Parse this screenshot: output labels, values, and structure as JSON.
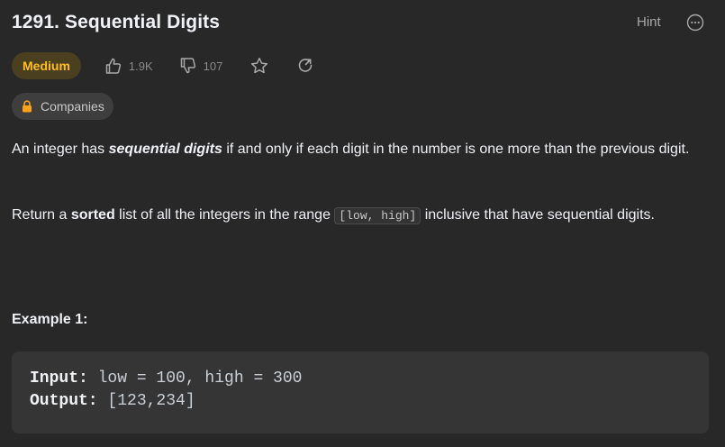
{
  "problem": {
    "title": "1291. Sequential Digits",
    "hint_label": "Hint",
    "difficulty": "Medium",
    "likes": "1.9K",
    "dislikes": "107",
    "companies_label": "Companies"
  },
  "description": {
    "p1_before": "An integer has ",
    "p1_em": "sequential digits",
    "p1_after": " if and only if each digit in the number is one more than the previous digit.",
    "p2_before": "Return a ",
    "p2_strong": "sorted",
    "p2_middle": " list of all the integers in the range ",
    "p2_code": "[low, high]",
    "p2_after": " inclusive that have sequential digits."
  },
  "example": {
    "title": "Example 1:",
    "input_label": "Input:",
    "input_value": " low = 100, high = 300",
    "output_label": "Output:",
    "output_value": " [123,234]"
  },
  "colors": {
    "background": "#282828",
    "medium_text": "#ffc01e",
    "medium_bg": "#4a3f1f",
    "muted": "#8a8a8a"
  },
  "icons": [
    "thumbs-up-icon",
    "thumbs-down-icon",
    "star-icon",
    "share-icon",
    "lock-icon",
    "more-icon"
  ]
}
